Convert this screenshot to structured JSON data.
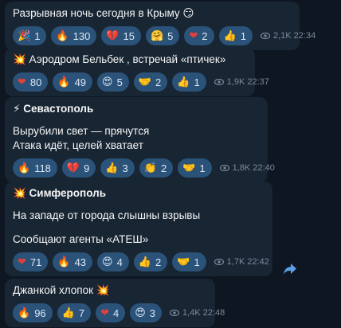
{
  "messages": [
    {
      "id": "m1",
      "title_icon": "",
      "lines": [
        "Разрывная ночь сегодня в Крыму 😏"
      ],
      "reactions": [
        {
          "emoji": "🎉",
          "icon": "party-icon",
          "count": "1"
        },
        {
          "emoji": "🔥",
          "icon": "fire-icon",
          "count": "130"
        },
        {
          "emoji": "💔",
          "icon": "broken-heart-icon",
          "count": "15"
        },
        {
          "emoji": "🤗",
          "icon": "hug-icon",
          "count": "5"
        },
        {
          "emoji": "❤",
          "icon": "heart-icon",
          "count": "2"
        },
        {
          "emoji": "👍",
          "icon": "thumbs-up-icon",
          "count": "1"
        }
      ],
      "views": "2,1K",
      "time": "22:34"
    },
    {
      "id": "m2",
      "lines": [
        "💥 Аэродром Бельбек , встречай «птичек»"
      ],
      "reactions": [
        {
          "emoji": "❤",
          "icon": "heart-icon",
          "count": "80"
        },
        {
          "emoji": "🔥",
          "icon": "fire-icon",
          "count": "49"
        },
        {
          "emoji": "😍",
          "icon": "heart-eyes-icon",
          "count": "5"
        },
        {
          "emoji": "🤝",
          "icon": "handshake-icon",
          "count": "2"
        },
        {
          "emoji": "👍",
          "icon": "thumbs-up-icon",
          "count": "1"
        }
      ],
      "views": "1,9K",
      "time": "22:37"
    },
    {
      "id": "m3",
      "title": "⚡ Севастополь",
      "lines": [
        "Вырубили свет — прячутся",
        "Атака идёт, целей хватает"
      ],
      "reactions": [
        {
          "emoji": "🔥",
          "icon": "fire-icon",
          "count": "118"
        },
        {
          "emoji": "💔",
          "icon": "broken-heart-icon",
          "count": "9"
        },
        {
          "emoji": "👍",
          "icon": "thumbs-up-icon",
          "count": "3"
        },
        {
          "emoji": "👏",
          "icon": "clap-icon",
          "count": "2"
        },
        {
          "emoji": "🤝",
          "icon": "handshake-icon",
          "count": "1"
        }
      ],
      "views": "1,8K",
      "time": "22:40"
    },
    {
      "id": "m4",
      "title": "💥 Симферополь",
      "lines": [
        "На западе от города слышны взрывы",
        "",
        "Сообщают агенты «АТЕШ»"
      ],
      "reactions": [
        {
          "emoji": "❤",
          "icon": "heart-icon",
          "count": "71"
        },
        {
          "emoji": "🔥",
          "icon": "fire-icon",
          "count": "43"
        },
        {
          "emoji": "😍",
          "icon": "heart-eyes-icon",
          "count": "4"
        },
        {
          "emoji": "👍",
          "icon": "thumbs-up-icon",
          "count": "2"
        },
        {
          "emoji": "🤝",
          "icon": "handshake-icon",
          "count": "1"
        }
      ],
      "views": "1,7K",
      "time": "22:42"
    },
    {
      "id": "m5",
      "lines": [
        "Джанкой хлопок 💥"
      ],
      "reactions": [
        {
          "emoji": "🔥",
          "icon": "fire-icon",
          "count": "96"
        },
        {
          "emoji": "👍",
          "icon": "thumbs-up-icon",
          "count": "7"
        },
        {
          "emoji": "❤",
          "icon": "heart-icon",
          "count": "4"
        },
        {
          "emoji": "😍",
          "icon": "heart-eyes-icon",
          "count": "3"
        }
      ],
      "views": "1,4K",
      "time": "22:48"
    }
  ],
  "colors": {
    "background": "#0e1621",
    "bubble": "#182533",
    "reaction": "#2b5278",
    "meta": "#7b8a9b",
    "share": "#5aa0e8"
  },
  "share_icon": "share-forward-icon"
}
